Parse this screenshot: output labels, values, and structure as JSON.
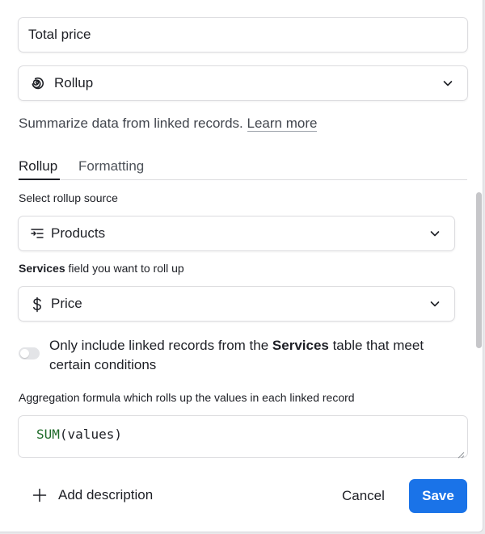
{
  "field_name": {
    "value": "Total price"
  },
  "field_type": {
    "label": "Rollup",
    "icon": "rollup-spiral-icon"
  },
  "description": {
    "text": "Summarize data from linked records.",
    "link": "Learn more"
  },
  "tabs": [
    {
      "label": "Rollup",
      "active": true
    },
    {
      "label": "Formatting",
      "active": false
    }
  ],
  "rollup_source": {
    "label": "Select rollup source",
    "value": "Products",
    "icon": "linked-table-icon"
  },
  "rollup_field": {
    "label_bold": "Services",
    "label_rest": " field you want to roll up",
    "value": "Price",
    "icon": "dollar-icon"
  },
  "conditions": {
    "text_before": "Only include linked records from the ",
    "text_bold": "Services",
    "text_after": " table that meet certain conditions",
    "enabled": false
  },
  "aggregation": {
    "label": "Aggregation formula which rolls up the values in each linked record",
    "formula_fn": "SUM",
    "formula_args": "(values)"
  },
  "footer": {
    "add_description": "Add description",
    "cancel": "Cancel",
    "save": "Save"
  },
  "colors": {
    "accent": "#1a73e8",
    "formula_fn": "#1f6b2a"
  }
}
